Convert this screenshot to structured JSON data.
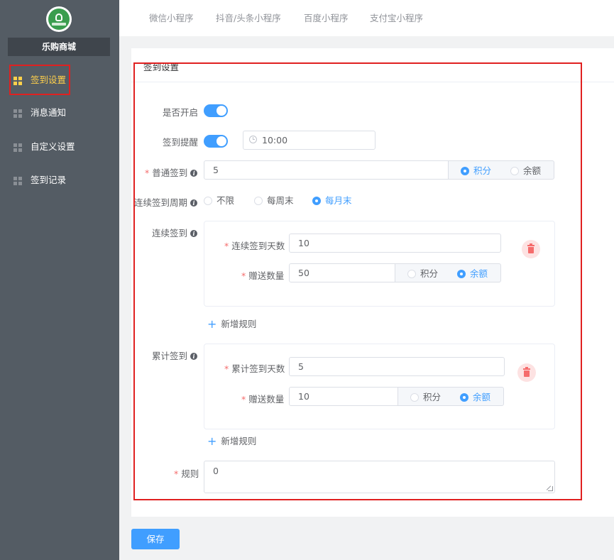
{
  "sidebar": {
    "shop_name": "乐购商城",
    "items": [
      {
        "label": "签到设置",
        "active": true
      },
      {
        "label": "消息通知",
        "active": false
      },
      {
        "label": "自定义设置",
        "active": false
      },
      {
        "label": "签到记录",
        "active": false
      }
    ]
  },
  "tabs": [
    "微信小程序",
    "抖音/头条小程序",
    "百度小程序",
    "支付宝小程序"
  ],
  "card": {
    "title": "签到设置"
  },
  "form": {
    "enable": {
      "label": "是否开启",
      "on": true
    },
    "reminder": {
      "label": "签到提醒",
      "on": true,
      "time": "10:00"
    },
    "normal": {
      "label": "普通签到",
      "value": "5",
      "options": [
        "积分",
        "余额"
      ],
      "selected": "积分"
    },
    "period": {
      "label": "连续签到周期",
      "options": [
        "不限",
        "每周末",
        "每月末"
      ],
      "selected": "每月末"
    },
    "continuous": {
      "label": "连续签到",
      "days_label": "连续签到天数",
      "days_value": "10",
      "gift_label": "赠送数量",
      "gift_value": "50",
      "options": [
        "积分",
        "余额"
      ],
      "selected": "余额",
      "add_rule": "新增规则"
    },
    "cumulative": {
      "label": "累计签到",
      "days_label": "累计签到天数",
      "days_value": "5",
      "gift_label": "赠送数量",
      "gift_value": "10",
      "options": [
        "积分",
        "余额"
      ],
      "selected": "余额",
      "add_rule": "新增规则"
    },
    "rules": {
      "label": "规则",
      "value": "0"
    }
  },
  "save_label": "保存",
  "colors": {
    "primary": "#409eff",
    "sidebar": "#545c64",
    "active": "#ffd04b",
    "danger": "#f56c6c",
    "highlight_frame": "#e02020"
  }
}
